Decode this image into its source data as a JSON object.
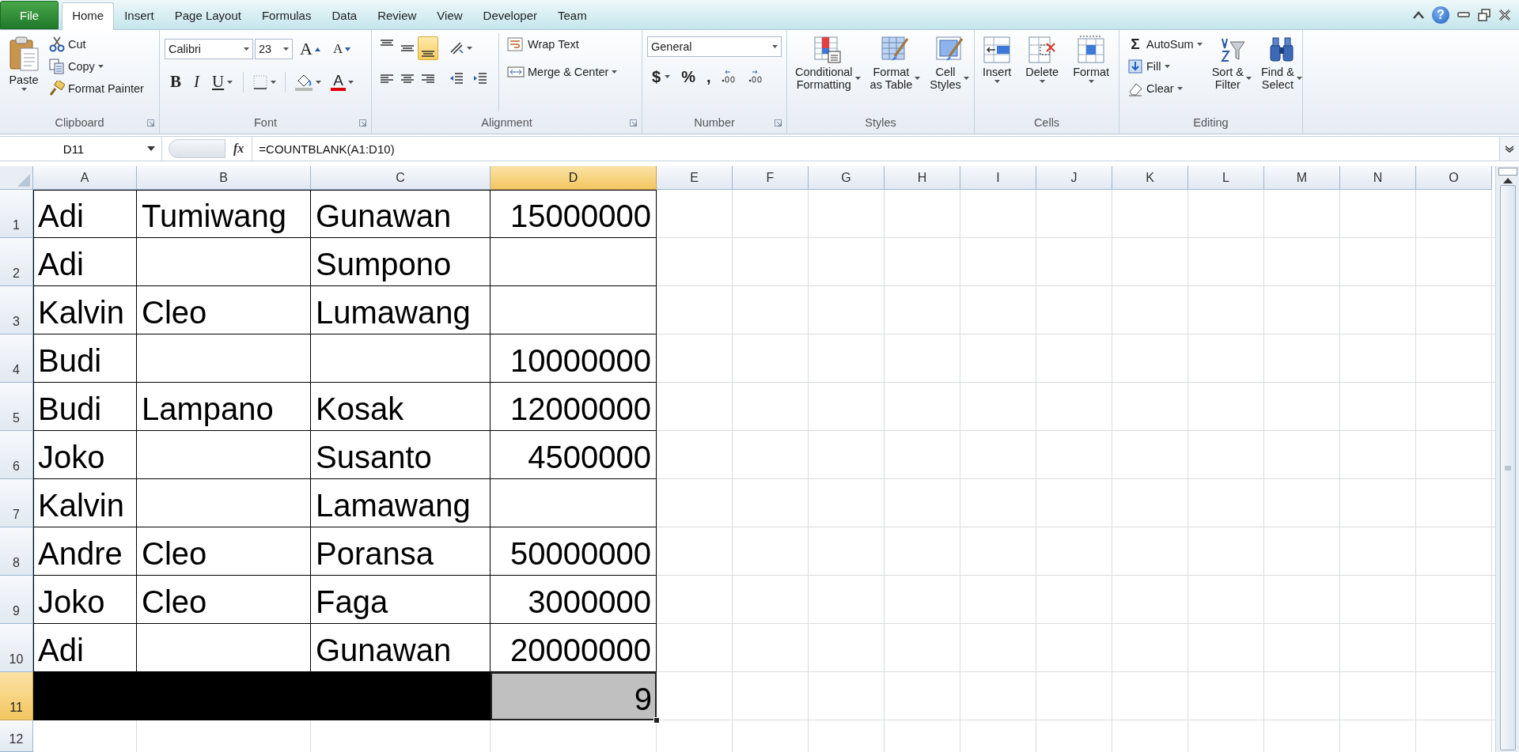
{
  "tabs": [
    {
      "label": "File",
      "kind": "file",
      "selected": false
    },
    {
      "label": "Home",
      "kind": "tab",
      "selected": true
    },
    {
      "label": "Insert",
      "kind": "tab",
      "selected": false
    },
    {
      "label": "Page Layout",
      "kind": "tab",
      "selected": false
    },
    {
      "label": "Formulas",
      "kind": "tab",
      "selected": false
    },
    {
      "label": "Data",
      "kind": "tab",
      "selected": false
    },
    {
      "label": "Review",
      "kind": "tab",
      "selected": false
    },
    {
      "label": "View",
      "kind": "tab",
      "selected": false
    },
    {
      "label": "Developer",
      "kind": "tab",
      "selected": false
    },
    {
      "label": "Team",
      "kind": "tab",
      "selected": false
    }
  ],
  "window_controls": {
    "help": "?"
  },
  "ribbon": {
    "groups": [
      {
        "title": "Clipboard",
        "kind": "clipboard",
        "launcher": true,
        "large": [
          {
            "lines": [
              "Paste"
            ],
            "dropdown": true
          }
        ],
        "small": [
          {
            "label": "Cut",
            "dropdown": false
          },
          {
            "label": "Copy",
            "dropdown": true
          },
          {
            "label": "Format Painter",
            "dropdown": false
          }
        ]
      },
      {
        "title": "Font",
        "kind": "font",
        "launcher": true,
        "font": "Calibri",
        "size": "23",
        "size_buttons": [
          {
            "label": "A",
            "kind": "grow"
          },
          {
            "label": "A",
            "kind": "shrink"
          }
        ],
        "styles": [
          {
            "label": "B",
            "kind": "bold"
          },
          {
            "label": "I",
            "kind": "italic"
          },
          {
            "label": "U",
            "kind": "underline"
          }
        ],
        "font_color": "A"
      },
      {
        "title": "Alignment",
        "kind": "alignment",
        "launcher": true,
        "align_buttons": [
          {
            "selected": false
          },
          {
            "selected": false
          },
          {
            "selected": true
          },
          {
            "selected": false
          },
          {
            "selected": false
          },
          {
            "selected": false
          }
        ],
        "wrap": "Wrap Text",
        "merge": "Merge & Center"
      },
      {
        "title": "Number",
        "kind": "number",
        "launcher": true,
        "format": "General",
        "symbols": [
          "$",
          "%",
          ","
        ]
      },
      {
        "title": "Styles",
        "kind": "styles",
        "launcher": false,
        "large": [
          {
            "lines": [
              "Conditional",
              "Formatting"
            ],
            "dropdown": true
          },
          {
            "lines": [
              "Format",
              "as Table"
            ],
            "dropdown": true
          },
          {
            "lines": [
              "Cell",
              "Styles"
            ],
            "dropdown": true
          }
        ]
      },
      {
        "title": "Cells",
        "kind": "cells",
        "launcher": false,
        "large": [
          {
            "lines": [
              "Insert"
            ],
            "dropdown": true
          },
          {
            "lines": [
              "Delete"
            ],
            "dropdown": true
          },
          {
            "lines": [
              "Format"
            ],
            "dropdown": true
          }
        ]
      },
      {
        "title": "Editing",
        "kind": "editing",
        "launcher": false,
        "small": [
          {
            "label": "AutoSum",
            "symbol": "Σ",
            "dropdown": true
          },
          {
            "label": "Fill",
            "dropdown": true
          },
          {
            "label": "Clear",
            "dropdown": true
          }
        ],
        "large": [
          {
            "lines": [
              "Sort &",
              "Filter"
            ],
            "dropdown": true
          },
          {
            "lines": [
              "Find &",
              "Select"
            ],
            "dropdown": true
          }
        ]
      }
    ]
  },
  "formula_bar": {
    "name_box": "D11",
    "fx": "fx",
    "formula": "=COUNTBLANK(A1:D10)"
  },
  "sheet": {
    "columns": [
      {
        "label": "A",
        "selected": false
      },
      {
        "label": "B",
        "selected": false
      },
      {
        "label": "C",
        "selected": false
      },
      {
        "label": "D",
        "selected": true
      },
      {
        "label": "E",
        "selected": false
      },
      {
        "label": "F",
        "selected": false
      },
      {
        "label": "G",
        "selected": false
      },
      {
        "label": "H",
        "selected": false
      },
      {
        "label": "I",
        "selected": false
      },
      {
        "label": "J",
        "selected": false
      },
      {
        "label": "K",
        "selected": false
      },
      {
        "label": "L",
        "selected": false
      },
      {
        "label": "M",
        "selected": false
      },
      {
        "label": "N",
        "selected": false
      },
      {
        "label": "O",
        "selected": false
      }
    ],
    "rows": [
      {
        "label": "1",
        "selected": false,
        "bordered": true,
        "cells": [
          {
            "kind": "text",
            "text": "Adi",
            "selected": false
          },
          {
            "kind": "text",
            "text": "Tumiwang",
            "selected": false
          },
          {
            "kind": "text",
            "text": "Gunawan",
            "selected": false
          },
          {
            "kind": "number",
            "text": "15000000",
            "selected": false
          }
        ]
      },
      {
        "label": "2",
        "selected": false,
        "bordered": true,
        "cells": [
          {
            "kind": "text",
            "text": "Adi",
            "selected": false
          },
          {
            "kind": "empty",
            "selected": false
          },
          {
            "kind": "text",
            "text": "Sumpono",
            "selected": false
          },
          {
            "kind": "empty",
            "selected": false
          }
        ]
      },
      {
        "label": "3",
        "selected": false,
        "bordered": true,
        "cells": [
          {
            "kind": "text",
            "text": "Kalvin",
            "selected": false
          },
          {
            "kind": "text",
            "text": "Cleo",
            "selected": false
          },
          {
            "kind": "text",
            "text": "Lumawang",
            "selected": false
          },
          {
            "kind": "empty",
            "selected": false
          }
        ]
      },
      {
        "label": "4",
        "selected": false,
        "bordered": true,
        "cells": [
          {
            "kind": "text",
            "text": "Budi",
            "selected": false
          },
          {
            "kind": "empty",
            "selected": false
          },
          {
            "kind": "empty",
            "selected": false
          },
          {
            "kind": "number",
            "text": "10000000",
            "selected": false
          }
        ]
      },
      {
        "label": "5",
        "selected": false,
        "bordered": true,
        "cells": [
          {
            "kind": "text",
            "text": "Budi",
            "selected": false
          },
          {
            "kind": "text",
            "text": "Lampano",
            "selected": false
          },
          {
            "kind": "text",
            "text": "Kosak",
            "selected": false
          },
          {
            "kind": "number",
            "text": "12000000",
            "selected": false
          }
        ]
      },
      {
        "label": "6",
        "selected": false,
        "bordered": true,
        "cells": [
          {
            "kind": "text",
            "text": "Joko",
            "selected": false
          },
          {
            "kind": "empty",
            "selected": false
          },
          {
            "kind": "text",
            "text": "Susanto",
            "selected": false
          },
          {
            "kind": "number",
            "text": "4500000",
            "selected": false
          }
        ]
      },
      {
        "label": "7",
        "selected": false,
        "bordered": true,
        "cells": [
          {
            "kind": "text",
            "text": "Kalvin",
            "selected": false
          },
          {
            "kind": "empty",
            "selected": false
          },
          {
            "kind": "text",
            "text": "Lamawang",
            "selected": false
          },
          {
            "kind": "empty",
            "selected": false
          }
        ]
      },
      {
        "label": "8",
        "selected": false,
        "bordered": true,
        "cells": [
          {
            "kind": "text",
            "text": "Andre",
            "selected": false
          },
          {
            "kind": "text",
            "text": "Cleo",
            "selected": false
          },
          {
            "kind": "text",
            "text": "Poransa",
            "selected": false
          },
          {
            "kind": "number",
            "text": "50000000",
            "selected": false
          }
        ]
      },
      {
        "label": "9",
        "selected": false,
        "bordered": true,
        "cells": [
          {
            "kind": "text",
            "text": "Joko",
            "selected": false
          },
          {
            "kind": "text",
            "text": "Cleo",
            "selected": false
          },
          {
            "kind": "text",
            "text": "Faga",
            "selected": false
          },
          {
            "kind": "number",
            "text": "3000000",
            "selected": false
          }
        ]
      },
      {
        "label": "10",
        "selected": false,
        "bordered": true,
        "cells": [
          {
            "kind": "text",
            "text": "Adi",
            "selected": false
          },
          {
            "kind": "empty",
            "selected": false
          },
          {
            "kind": "text",
            "text": "Gunawan",
            "selected": false
          },
          {
            "kind": "number",
            "text": "20000000",
            "selected": false
          }
        ]
      },
      {
        "label": "11",
        "selected": true,
        "bordered": false,
        "cells": [
          {
            "kind": "empty",
            "color": "#000000",
            "selected": false
          },
          {
            "kind": "empty",
            "color": "#000000",
            "selected": false
          },
          {
            "kind": "empty",
            "color": "#000000",
            "selected": false
          },
          {
            "kind": "number",
            "text": "9",
            "color": "#c0c0c0",
            "selected": true
          }
        ]
      },
      {
        "label": "12",
        "selected": false
      }
    ]
  }
}
